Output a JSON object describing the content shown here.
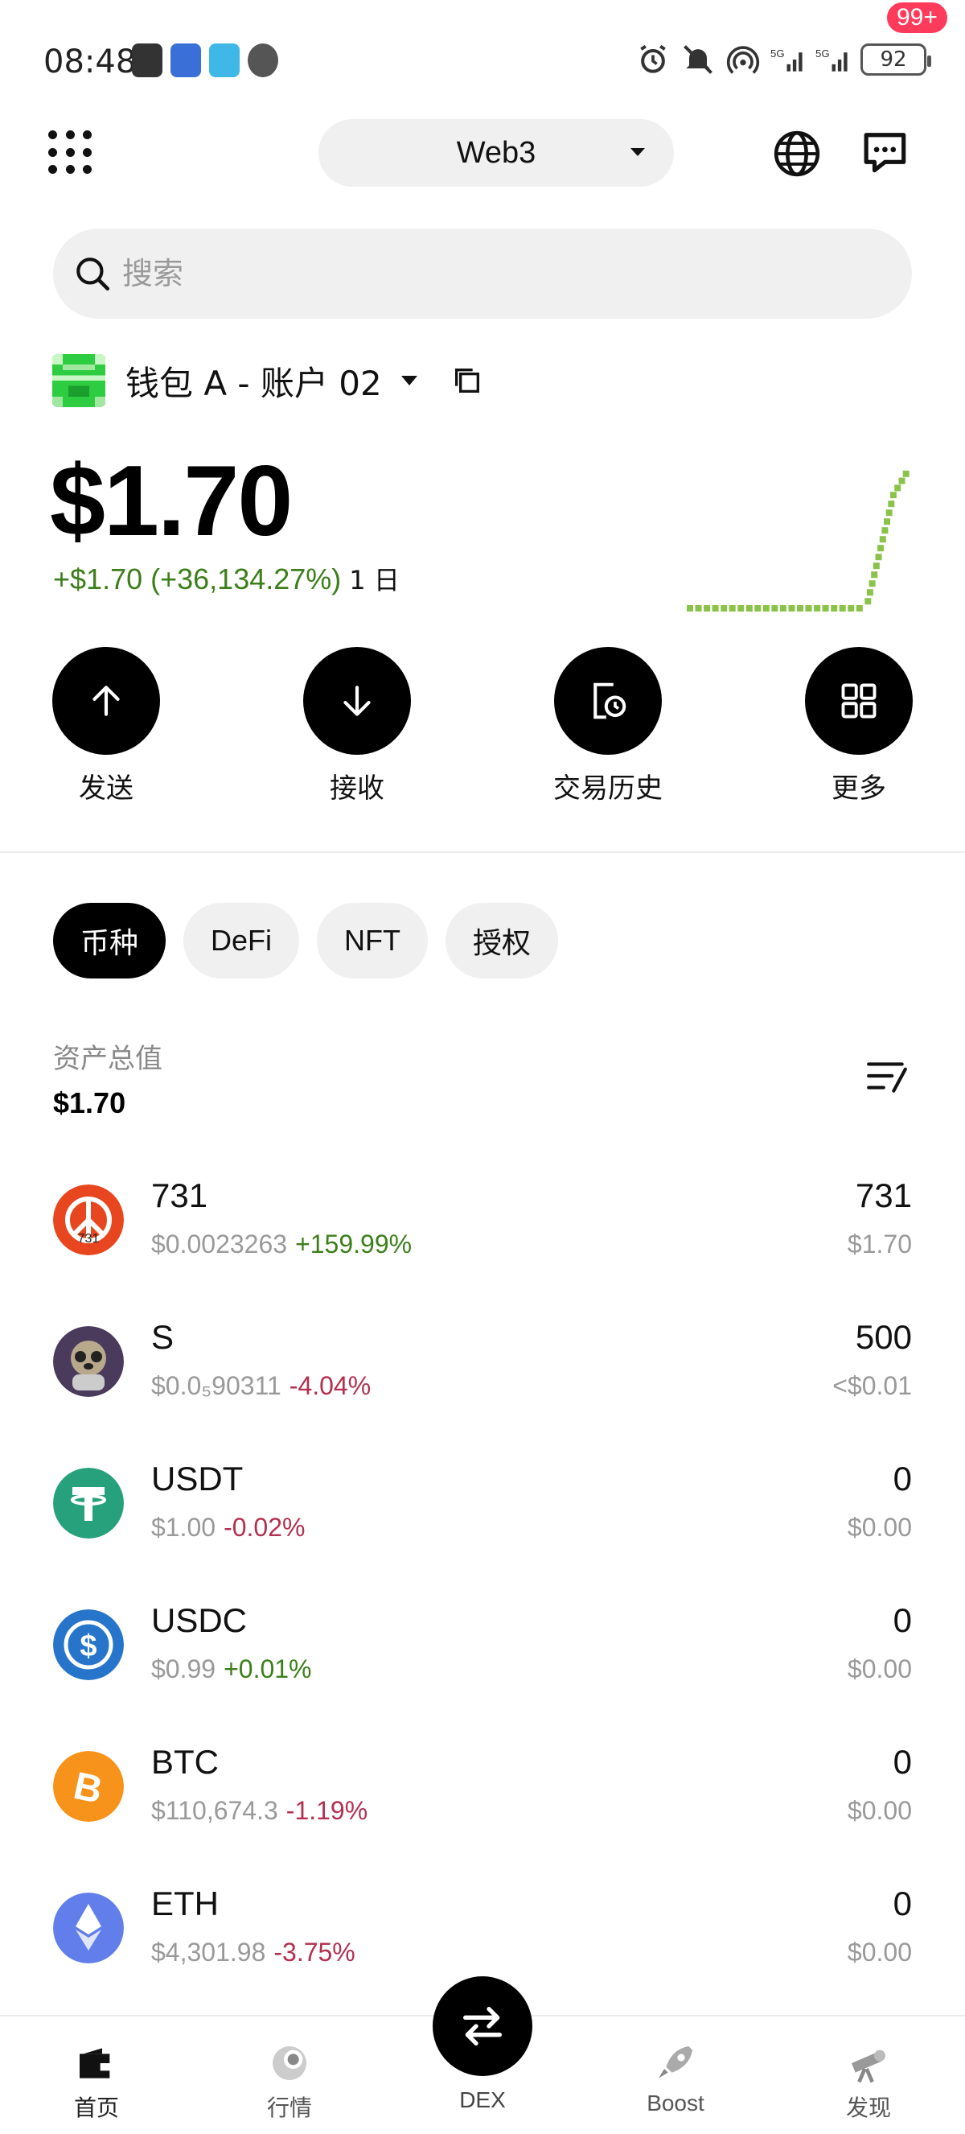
{
  "status_bar": {
    "time": "08:48",
    "battery": "92"
  },
  "header": {
    "network": "Web3",
    "badge": "99+"
  },
  "search": {
    "placeholder": "搜索"
  },
  "wallet": {
    "name": "钱包 A - 账户 02",
    "balance": "$1.70",
    "change": "+$1.70 (+36,134.27%)",
    "period": "1 日"
  },
  "sparkline": {
    "color": "#8bc34a",
    "values": [
      0,
      0,
      0,
      0,
      0,
      0,
      0,
      0,
      0,
      0,
      0,
      0,
      0,
      0,
      0,
      0,
      0,
      0,
      0,
      0,
      0,
      0.05,
      0.3,
      0.55,
      0.8,
      0.9,
      1.0
    ]
  },
  "actions": [
    {
      "label": "发送",
      "icon": "arrow-up-icon"
    },
    {
      "label": "接收",
      "icon": "arrow-down-icon"
    },
    {
      "label": "交易历史",
      "icon": "history-icon"
    },
    {
      "label": "更多",
      "icon": "grid-icon"
    }
  ],
  "tabs": [
    "币种",
    "DeFi",
    "NFT",
    "授权"
  ],
  "totals": {
    "label": "资产总值",
    "value": "$1.70"
  },
  "tokens": [
    {
      "symbol": "731",
      "price": "$0.0023263",
      "change": "+159.99%",
      "direction": "up",
      "qty": "731",
      "value": "$1.70"
    },
    {
      "symbol": "S",
      "price": "$0.0₅90311",
      "change": "-4.04%",
      "direction": "down",
      "qty": "500",
      "value": "<$0.01"
    },
    {
      "symbol": "USDT",
      "price": "$1.00",
      "change": "-0.02%",
      "direction": "down",
      "qty": "0",
      "value": "$0.00"
    },
    {
      "symbol": "USDC",
      "price": "$0.99",
      "change": "+0.01%",
      "direction": "up",
      "qty": "0",
      "value": "$0.00"
    },
    {
      "symbol": "BTC",
      "price": "$110,674.3",
      "change": "-1.19%",
      "direction": "down",
      "qty": "0",
      "value": "$0.00"
    },
    {
      "symbol": "ETH",
      "price": "$4,301.98",
      "change": "-3.75%",
      "direction": "down",
      "qty": "0",
      "value": "$0.00"
    }
  ],
  "bottom_nav": {
    "home": "首页",
    "market": "行情",
    "dex": "DEX",
    "boost": "Boost",
    "discover": "发现"
  },
  "colors": {
    "up": "#3c7f1a",
    "down": "#b3304f",
    "badge": "#ff3b5c"
  }
}
